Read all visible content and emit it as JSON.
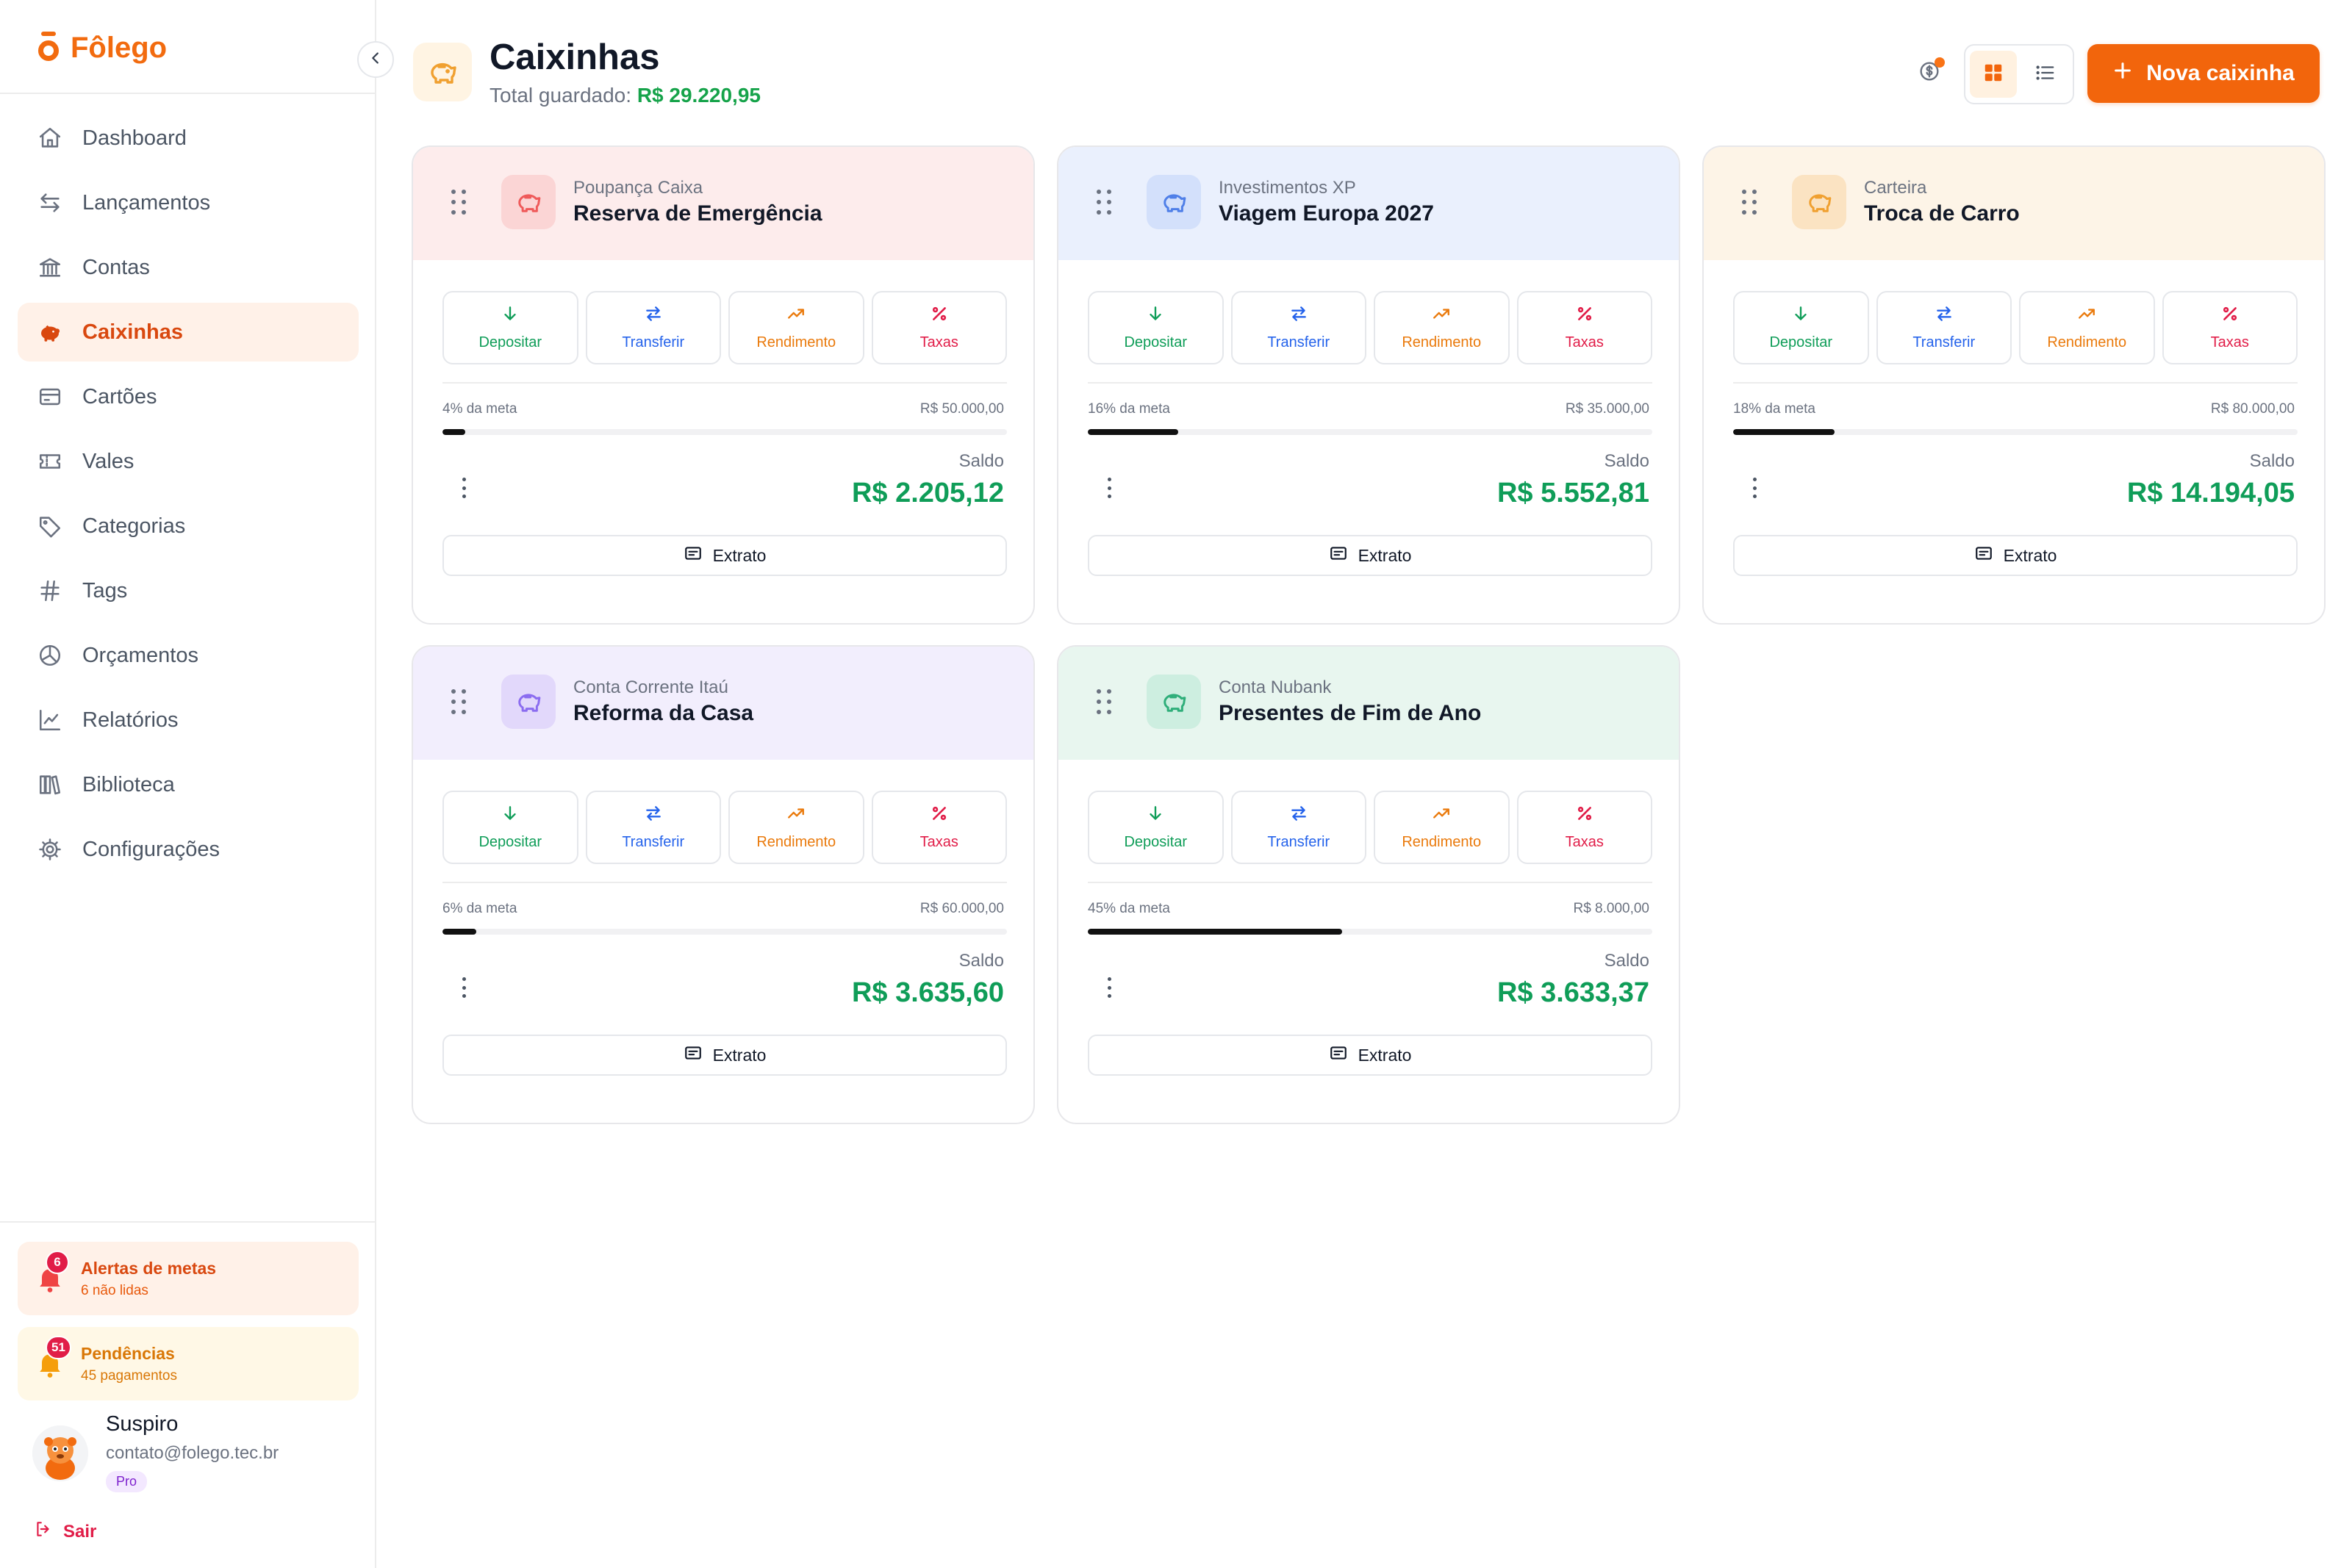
{
  "app": {
    "name": "Fôlego",
    "brand_color": "#f26b0f"
  },
  "sidebar": {
    "items": [
      {
        "label": "Dashboard",
        "icon": "home-icon",
        "active": false
      },
      {
        "label": "Lançamentos",
        "icon": "arrows-left-right-icon",
        "active": false
      },
      {
        "label": "Contas",
        "icon": "bank-icon",
        "active": false
      },
      {
        "label": "Caixinhas",
        "icon": "piggy-bank-icon",
        "active": true
      },
      {
        "label": "Cartões",
        "icon": "credit-card-icon",
        "active": false
      },
      {
        "label": "Vales",
        "icon": "ticket-icon",
        "active": false
      },
      {
        "label": "Categorias",
        "icon": "tag-icon",
        "active": false
      },
      {
        "label": "Tags",
        "icon": "hash-icon",
        "active": false
      },
      {
        "label": "Orçamentos",
        "icon": "pie-chart-icon",
        "active": false
      },
      {
        "label": "Relatórios",
        "icon": "line-chart-icon",
        "active": false
      },
      {
        "label": "Biblioteca",
        "icon": "library-icon",
        "active": false
      },
      {
        "label": "Configurações",
        "icon": "gear-icon",
        "active": false
      }
    ],
    "alerts": {
      "metas": {
        "badge": "6",
        "title": "Alertas de metas",
        "subtitle": "6 não lidas"
      },
      "pendencias": {
        "badge": "51",
        "title": "Pendências",
        "subtitle": "45 pagamentos"
      }
    },
    "user": {
      "name": "Suspiro",
      "email": "contato@folego.tec.br",
      "plan": "Pro"
    },
    "logout_label": "Sair"
  },
  "header": {
    "title": "Caixinhas",
    "total_label": "Total guardado:",
    "total_value": "R$ 29.220,95",
    "view_mode": "grid",
    "new_button_label": "Nova caixinha"
  },
  "actions": {
    "deposit": "Depositar",
    "transfer": "Transferir",
    "yield": "Rendimento",
    "fees": "Taxas"
  },
  "labels": {
    "balance": "Saldo",
    "statement": "Extrato"
  },
  "cards": [
    {
      "account": "Poupança Caixa",
      "name": "Reserva de Emergência",
      "goal_pct_label": "4% da meta",
      "goal_progress": 0.04,
      "goal_target": "R$ 50.000,00",
      "balance": "R$ 2.205,12",
      "theme_bg": "#fdecec",
      "icon_bg": "#fbd5d5",
      "icon_color": "#ef5a5a"
    },
    {
      "account": "Investimentos XP",
      "name": "Viagem Europa 2027",
      "goal_pct_label": "16% da meta",
      "goal_progress": 0.16,
      "goal_target": "R$ 35.000,00",
      "balance": "R$ 5.552,81",
      "theme_bg": "#eaf0fd",
      "icon_bg": "#d3e0fb",
      "icon_color": "#4f7fe8"
    },
    {
      "account": "Carteira",
      "name": "Troca de Carro",
      "goal_pct_label": "18% da meta",
      "goal_progress": 0.18,
      "goal_target": "R$ 80.000,00",
      "balance": "R$ 14.194,05",
      "theme_bg": "#fdf4e7",
      "icon_bg": "#fbe3c2",
      "icon_color": "#f0a030"
    },
    {
      "account": "Conta Corrente Itaú",
      "name": "Reforma da Casa",
      "goal_pct_label": "6% da meta",
      "goal_progress": 0.06,
      "goal_target": "R$ 60.000,00",
      "balance": "R$ 3.635,60",
      "theme_bg": "#f2eefd",
      "icon_bg": "#e2d8fb",
      "icon_color": "#8b6cf0"
    },
    {
      "account": "Conta Nubank",
      "name": "Presentes de Fim de Ano",
      "goal_pct_label": "45% da meta",
      "goal_progress": 0.45,
      "goal_target": "R$ 8.000,00",
      "balance": "R$ 3.633,37",
      "theme_bg": "#e8f6ef",
      "icon_bg": "#cdeee0",
      "icon_color": "#2fae7a"
    }
  ]
}
